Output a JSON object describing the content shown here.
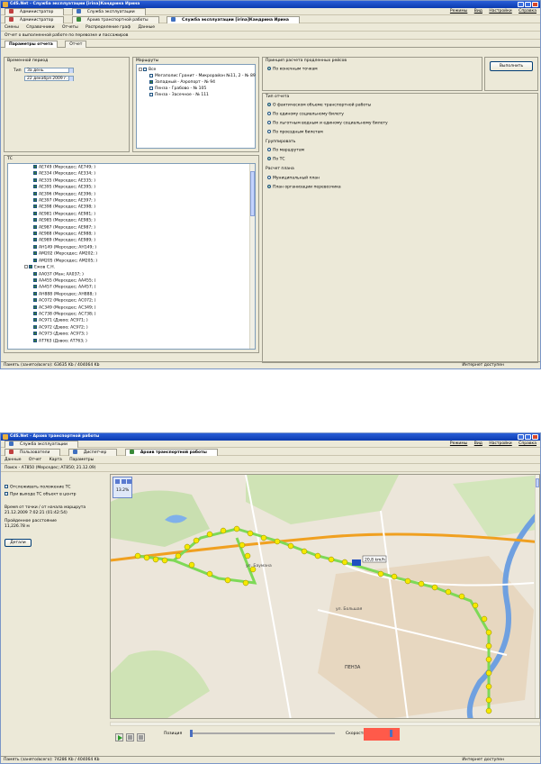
{
  "s1": {
    "title": "CdS.Net - Служба эксплуатации [irina]Кандрина Ирина",
    "toolbar": {
      "admin": "Администратор",
      "service": "Служба эксплуатации"
    },
    "right_menu": [
      "Режимы",
      "Вид",
      "Настройки",
      "Справка"
    ],
    "mdi_tabs": [
      "Администратор",
      "Архив транспортной работы",
      "Служба эксплуатации [irina]Кандрина Ирина"
    ],
    "menu": [
      "Смены",
      "Справочники",
      "Отчеты",
      "Распределение граф",
      "Данные"
    ],
    "report_title": "Отчет о выполненной работе по перевозке и пассажиров",
    "subtabs": [
      "Параметры отчета",
      "Отчет"
    ],
    "period": {
      "group": "Временной период",
      "type_label": "Тип",
      "type_value": "За день",
      "date_value": "22 декабря 2009 г."
    },
    "routes": {
      "group": "Маршруты",
      "root": "Все",
      "items": [
        {
          "label": "Мегаполис Гранит - Микрорайон №11, 2 - № 89",
          "checked": false
        },
        {
          "label": "Западный - Аэропорт - № 94",
          "checked": true
        },
        {
          "label": "Пенза - Грабово - № 105",
          "checked": false
        },
        {
          "label": "Пенза - Засечное - № 111",
          "checked": false
        }
      ]
    },
    "principle": {
      "group": "Принцип расчета продленных рейсов",
      "option": "По конечным точкам"
    },
    "execute_button": "Выполнить",
    "report_type": {
      "group": "Тип отчета",
      "options": [
        {
          "label": "О фактическом объеме транспортной работы",
          "on": true
        },
        {
          "label": "По единому социальному билету",
          "on": false
        },
        {
          "label": "По льготным водным и единому социальному билету",
          "on": false
        },
        {
          "label": "По проездным билетам",
          "on": false
        }
      ]
    },
    "grouping": {
      "group": "Группировать",
      "options": [
        {
          "label": "По маршрутам",
          "on": false
        },
        {
          "label": "По ТС",
          "on": true
        }
      ]
    },
    "plan": {
      "group": "Расчет плана",
      "options": [
        {
          "label": "Муниципальный план",
          "on": false
        },
        {
          "label": "План организации перевозчика",
          "on": true
        }
      ]
    },
    "ts": {
      "group": "ТС",
      "rows": [
        "АЕ749 (Мерседес; АЕ749; )",
        "АЕ334 (Мерседес; АЕ334; )",
        "АЕ335 (Мерседес; АЕ335; )",
        "АЕ395 (Мерседес; АЕ395; )",
        "АЕ396 (Мерседес; АЕ396; )",
        "АЕ397 (Мерседес; АЕ397; )",
        "АЕ398 (Мерседес; АЕ398; )",
        "АЕ981 (Мерседес; АЕ981; )",
        "АЕ985 (Мерседес; АЕ985; )",
        "АЕ987 (Мерседес; АЕ987; )",
        "АЕ988 (Мерседес; АЕ988; )",
        "АЕ989 (Мерседес; АЕ989; )",
        "АН149 (Мерседес; АН149; )",
        "АМ202 (Мерседес; АМ202; )",
        "АМ205 (Мерседес; АМ205; )"
      ],
      "owner": "Ежов С.Н.",
      "rows2": [
        "АА037 (Ман; АА037; )",
        "АА455 (Мерседес; АА455; )",
        "АА457 (Мерседес; АА457; )",
        "АН888 (Мерседес; АН888; )",
        "АС072 (Мерседес; АС072; )",
        "АС349 (Мерседес; АС349; )",
        "АС738 (Мерседес; АС738; )",
        "АС971 (Дэвоо; АС971; )",
        "АС972 (Дэвоо; АС972; )",
        "АС973 (Дэвоо; АС973; )",
        "АТ763 (Дэвоо; АТ763; )"
      ]
    },
    "status": {
      "memory": "Память (занято/всего): 63635 Kb / 404064 Kb",
      "internet": "Интернет доступен"
    }
  },
  "s2": {
    "title": "CdS.Net - Архив транспортной работы",
    "toolbar": {
      "service": "Служба эксплуатации"
    },
    "right_menu": [
      "Режимы",
      "Вид",
      "Настройки",
      "Справка"
    ],
    "mdi_tabs": [
      "Пользователи",
      "Диспетчер",
      "Архив транспортной работы"
    ],
    "menu": [
      "Данные",
      "Отчет",
      "Карта",
      "Параметры"
    ],
    "vehicle_line": "Поиск - АТ850 (Мерседес; АТ850; 21.12.09)",
    "options": [
      {
        "label": "Отслеживать положение ТС",
        "checked": false
      },
      {
        "label": "При выходе ТС объект в центр",
        "checked": false
      }
    ],
    "time_label": "Время от точки / от начала маршрута",
    "time_value": "21.12.2009 7:02:21 (01:42:54)",
    "distance_label": "Пройденное расстояние",
    "distance_value": "11,226.78 м",
    "details_button": "Детали",
    "zoom_label": "13.2%",
    "map_labels": {
      "street1": "ул. Баумана",
      "street2": "ул. Большая",
      "city": "ПЕНЗА",
      "dist": "20,8 km/h"
    },
    "position_label": "Позиция",
    "speed_label": "Скорость",
    "status": {
      "memory": "Память (занято/всего): 74286 Kb / 404064 Kb",
      "internet": "Интернет доступен"
    }
  }
}
